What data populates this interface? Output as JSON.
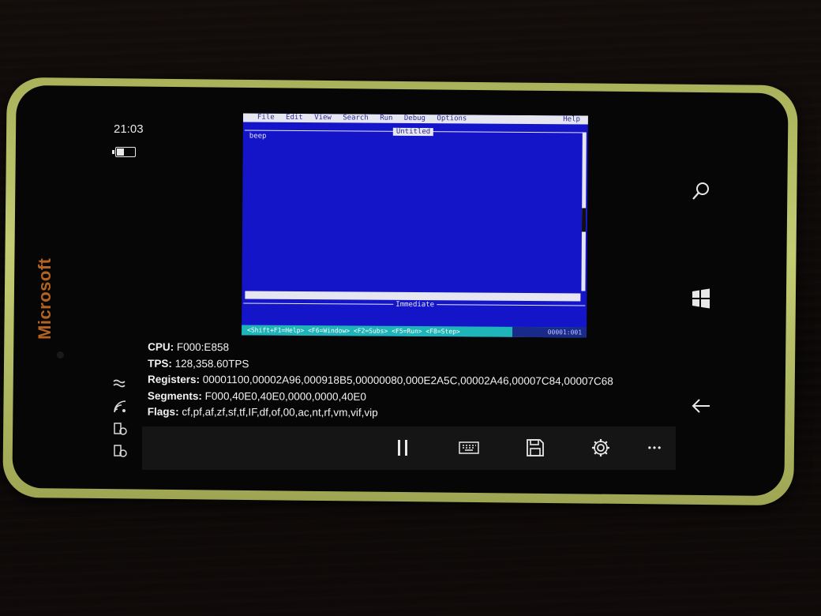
{
  "device": {
    "brand": "Microsoft",
    "time": "21:03"
  },
  "dos": {
    "menu": [
      "File",
      "Edit",
      "View",
      "Search",
      "Run",
      "Debug",
      "Options"
    ],
    "help": "Help",
    "title": "Untitled",
    "content": "beep",
    "immediate_label": "Immediate",
    "status_hint": "<Shift+F1=Help> <F6=Window> <F2=Subs> <F5=Run> <F8=Step>",
    "position": "00001:001",
    "colors": {
      "background": "#1414c8",
      "status": "#1fb5b8",
      "text": "#e6e6f0"
    }
  },
  "debug": {
    "cpu_label": "CPU:",
    "cpu_value": " F000:E858",
    "tps_label": "TPS:",
    "tps_value": " 128,358.60TPS",
    "registers_label": "Registers:",
    "registers_value": " 00001100,00002A96,000918B5,00000080,000E2A5C,00002A46,00007C84,00007C68",
    "segments_label": "Segments:",
    "segments_value": " F000,40E0,40E0,0000,0000,40E0",
    "flags_label": "Flags:",
    "flags_value": " cf,pf,af,zf,sf,tf,IF,df,of,00,ac,nt,rf,vm,vif,vip"
  },
  "appbar": {
    "buttons": [
      "pause-icon",
      "keyboard-icon",
      "save-icon",
      "settings-icon",
      "more-icon"
    ],
    "more_glyph": "•••"
  },
  "nav": {
    "buttons": [
      "search-icon",
      "windows-start-icon",
      "back-icon"
    ]
  }
}
